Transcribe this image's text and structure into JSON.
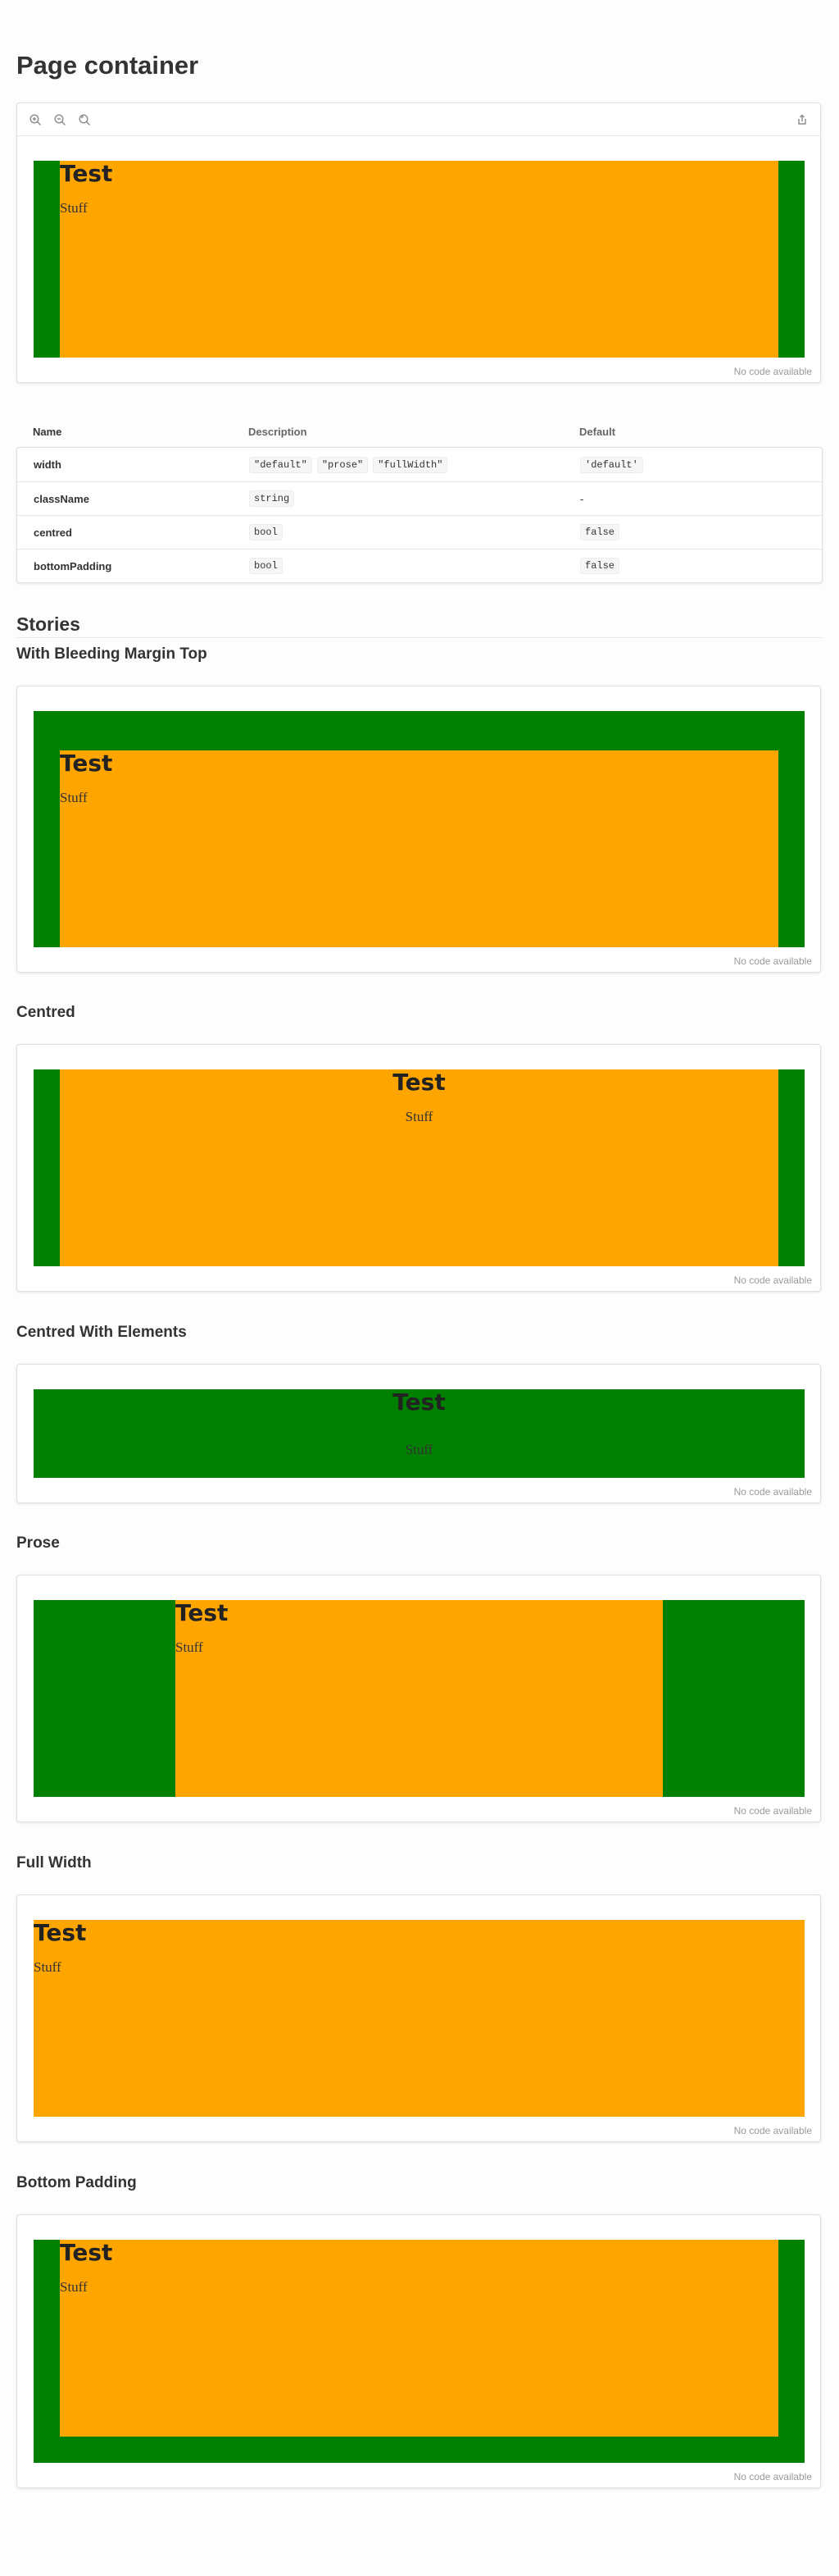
{
  "page": {
    "title": "Page container"
  },
  "toolbar": {
    "zoom_in": "zoom-in-icon",
    "zoom_out": "zoom-out-icon",
    "reset": "reset-zoom-icon",
    "share": "share-icon"
  },
  "demo": {
    "heading": "Test",
    "body": "Stuff"
  },
  "canvas": {
    "no_code": "No code available"
  },
  "props": {
    "headers": [
      "Name",
      "Description",
      "Default"
    ],
    "rows": [
      {
        "name": "width",
        "description": [
          "\"default\"",
          "\"prose\"",
          "\"fullWidth\""
        ],
        "default": "'default'",
        "default_is_code": true
      },
      {
        "name": "className",
        "description": [
          "string"
        ],
        "default": "-",
        "default_is_code": false
      },
      {
        "name": "centred",
        "description": [
          "bool"
        ],
        "default": "false",
        "default_is_code": true
      },
      {
        "name": "bottomPadding",
        "description": [
          "bool"
        ],
        "default": "false",
        "default_is_code": true
      }
    ]
  },
  "stories": {
    "title": "Stories",
    "items": [
      {
        "title": "With Bleeding Margin Top"
      },
      {
        "title": "Centred"
      },
      {
        "title": "Centred With Elements"
      },
      {
        "title": "Prose"
      },
      {
        "title": "Full Width"
      },
      {
        "title": "Bottom Padding"
      }
    ]
  },
  "colors": {
    "container": "#008000",
    "content": "#ffa500"
  }
}
